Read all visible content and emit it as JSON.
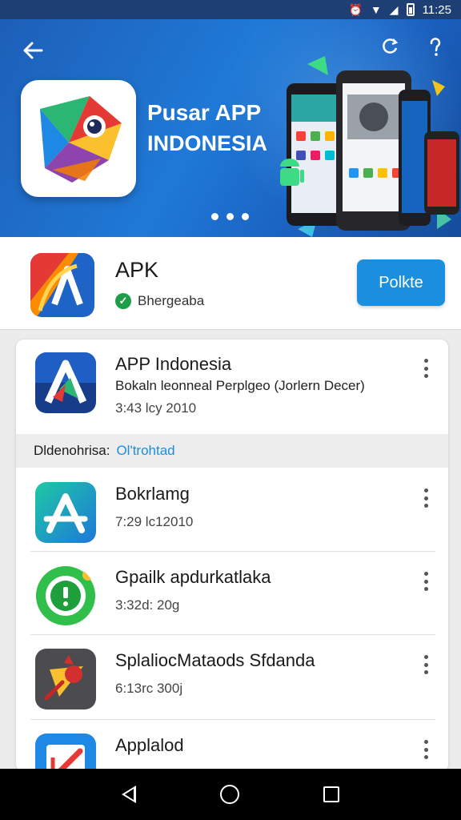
{
  "status_bar": {
    "time": "11:25"
  },
  "banner": {
    "title_line1": "Pusar APP",
    "title_line2": "INDONESIA"
  },
  "app": {
    "name": "APK",
    "verified_label": "Bhergeaba",
    "action_label": "Polkte"
  },
  "list": {
    "featured": {
      "title": "APP Indonesia",
      "subtitle": "Bokaln leonneal Perplgeo (Jorlern Decer)",
      "meta": "3:43 lcy 2010"
    },
    "section": {
      "label": "Dldenohrisa:",
      "link": "Ol'trohtad"
    },
    "items": [
      {
        "title": "Bokrlamg",
        "meta": "7:29 lc12010"
      },
      {
        "title": "Gpailk apdurkatlaka",
        "meta": "3:32d: 20g"
      },
      {
        "title": "SplaliocMataods Sfdanda",
        "meta": "6:13rc 300j"
      },
      {
        "title": "Applalod",
        "meta": ""
      }
    ]
  },
  "colors": {
    "banner_blue": "#1f79d6",
    "accent_blue": "#1a8fe0",
    "verified_green": "#1f9e4a"
  }
}
